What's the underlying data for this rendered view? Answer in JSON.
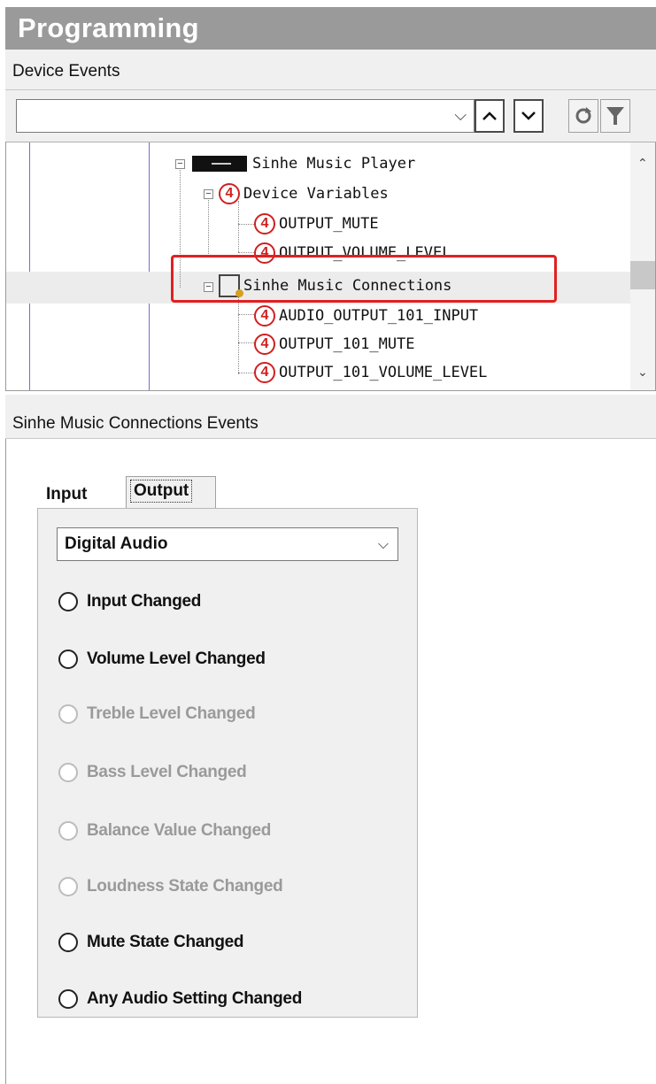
{
  "header": {
    "title": "Programming"
  },
  "device_events": {
    "label": "Device Events",
    "combo_value": ""
  },
  "tree": {
    "items": [
      {
        "label": "Sinhe Music Player"
      },
      {
        "label": "Device Variables"
      },
      {
        "label": "OUTPUT_MUTE"
      },
      {
        "label": "OUTPUT_VOLUME_LEVEL"
      },
      {
        "label": "Sinhe Music Connections"
      },
      {
        "label": "AUDIO_OUTPUT_101_INPUT"
      },
      {
        "label": "OUTPUT_101_MUTE"
      },
      {
        "label": "OUTPUT_101_VOLUME_LEVEL"
      }
    ],
    "selected": "Sinhe Music Connections"
  },
  "events": {
    "header": "Sinhe Music Connections Events",
    "tabs": [
      {
        "label": "Input",
        "active": false
      },
      {
        "label": "Output",
        "active": true
      }
    ],
    "select_value": "Digital Audio",
    "options": [
      {
        "label": "Input Changed",
        "enabled": true
      },
      {
        "label": "Volume Level Changed",
        "enabled": true
      },
      {
        "label": "Treble Level Changed",
        "enabled": false
      },
      {
        "label": "Bass Level Changed",
        "enabled": false
      },
      {
        "label": "Balance Value Changed",
        "enabled": false
      },
      {
        "label": "Loudness State Changed",
        "enabled": false
      },
      {
        "label": "Mute State Changed",
        "enabled": true
      },
      {
        "label": "Any Audio Setting Changed",
        "enabled": true
      }
    ]
  },
  "colors": {
    "header_bg": "#9a9a9a",
    "highlight_border": "#e02020",
    "control4_red": "#d02020"
  }
}
